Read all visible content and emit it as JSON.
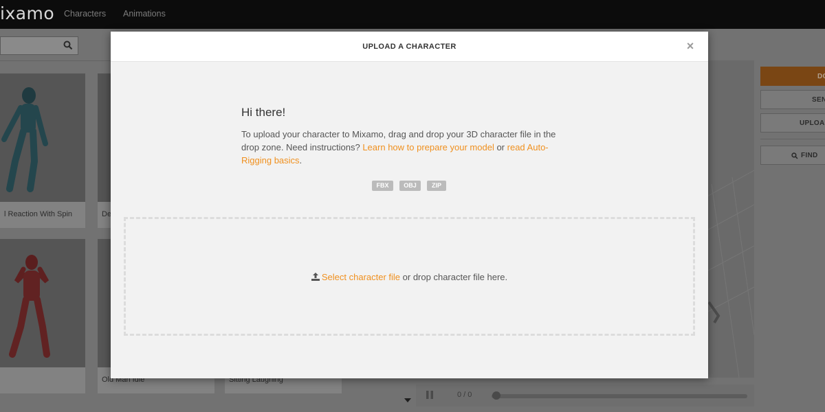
{
  "app": {
    "logo": "ixamo",
    "nav": [
      "Characters",
      "Animations"
    ]
  },
  "background": {
    "cards": [
      {
        "label": "l Reaction With Spin"
      },
      {
        "label": "De"
      },
      {
        "label": ""
      },
      {
        "label": "Old Man Idle"
      },
      {
        "label": "Sitting Laughing"
      }
    ],
    "player": {
      "time": "0 / 0"
    },
    "right_buttons": [
      "DO",
      "SEN",
      "UPLOA",
      "FIND"
    ]
  },
  "modal": {
    "title": "UPLOAD A CHARACTER",
    "close": "×",
    "greeting": "Hi there!",
    "desc_part1": "To upload your character to Mixamo, drag and drop your 3D character file in the drop zone. Need instructions? ",
    "link_prepare": "Learn how to prepare your model",
    "desc_part2": " or ",
    "link_autorig": "read Auto-Rigging basics",
    "desc_part3": ".",
    "formats": [
      "FBX",
      "OBJ",
      "ZIP"
    ],
    "dropzone": {
      "link": "Select character file",
      "text": " or drop character file here."
    }
  },
  "colors": {
    "accent": "#f0901e",
    "nav_bg": "#0c0c0c",
    "modal_bg": "#f2f2f2",
    "badge_bg": "#bbbbbb"
  }
}
